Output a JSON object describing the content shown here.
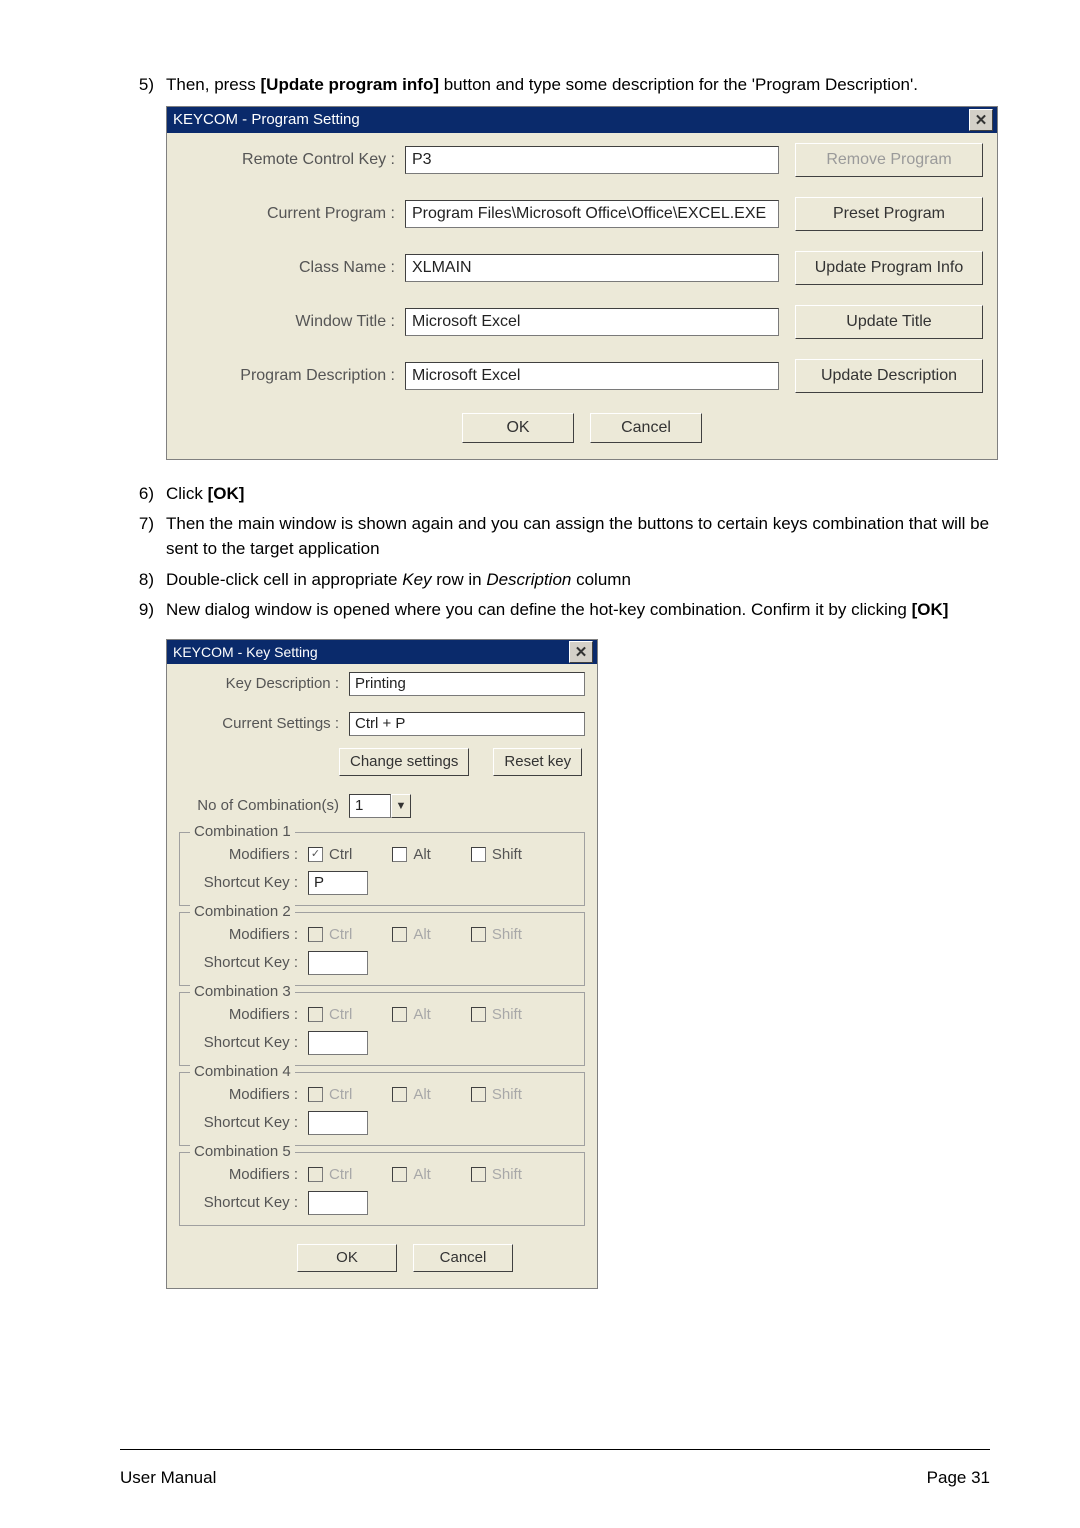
{
  "steps": {
    "s5a": "Then, press ",
    "s5b": "[Update program info]",
    "s5c": " button and type some description for the 'Program Description'.",
    "s6a": "Click ",
    "s6b": "[OK]",
    "s7": "Then the main window is shown again and you can assign the buttons to certain keys combination that will be sent to the target application",
    "s8a": "Double-click cell in appropriate ",
    "s8b": "Key",
    "s8c": " row in ",
    "s8d": "Description",
    "s8e": " column",
    "s9a": "New dialog window is opened where you can define the hot-key combination. Confirm it by clicking ",
    "s9b": "[OK]"
  },
  "dlg1": {
    "title": "KEYCOM - Program Setting",
    "labels": {
      "rck": "Remote Control Key :",
      "cp": "Current Program :",
      "cn": "Class Name :",
      "wt": "Window Title :",
      "pd": "Program Description :"
    },
    "values": {
      "rck": "P3",
      "cp": "Program Files\\Microsoft Office\\Office\\EXCEL.EXE",
      "cn": "XLMAIN",
      "wt": "Microsoft Excel",
      "pd": "Microsoft Excel"
    },
    "buttons": {
      "remove": "Remove Program",
      "preset": "Preset Program",
      "update_info": "Update Program Info",
      "update_title": "Update Title",
      "update_desc": "Update Description",
      "ok": "OK",
      "cancel": "Cancel"
    }
  },
  "dlg2": {
    "title": "KEYCOM - Key Setting",
    "labels": {
      "kd": "Key Description :",
      "cs": "Current Settings :",
      "noc": "No of Combination(s)",
      "mod": "Modifiers :",
      "shk": "Shortcut Key :",
      "ctrl": "Ctrl",
      "alt": "Alt",
      "shift": "Shift"
    },
    "values": {
      "kd": "Printing",
      "cs": "Ctrl + P",
      "noc": "1",
      "c1_short": "P"
    },
    "buttons": {
      "change": "Change settings",
      "reset": "Reset key",
      "ok": "OK",
      "cancel": "Cancel"
    },
    "legends": {
      "c1": "Combination 1",
      "c2": "Combination 2",
      "c3": "Combination 3",
      "c4": "Combination 4",
      "c5": "Combination 5"
    }
  },
  "footer": {
    "left": "User Manual",
    "right": "Page 31"
  }
}
